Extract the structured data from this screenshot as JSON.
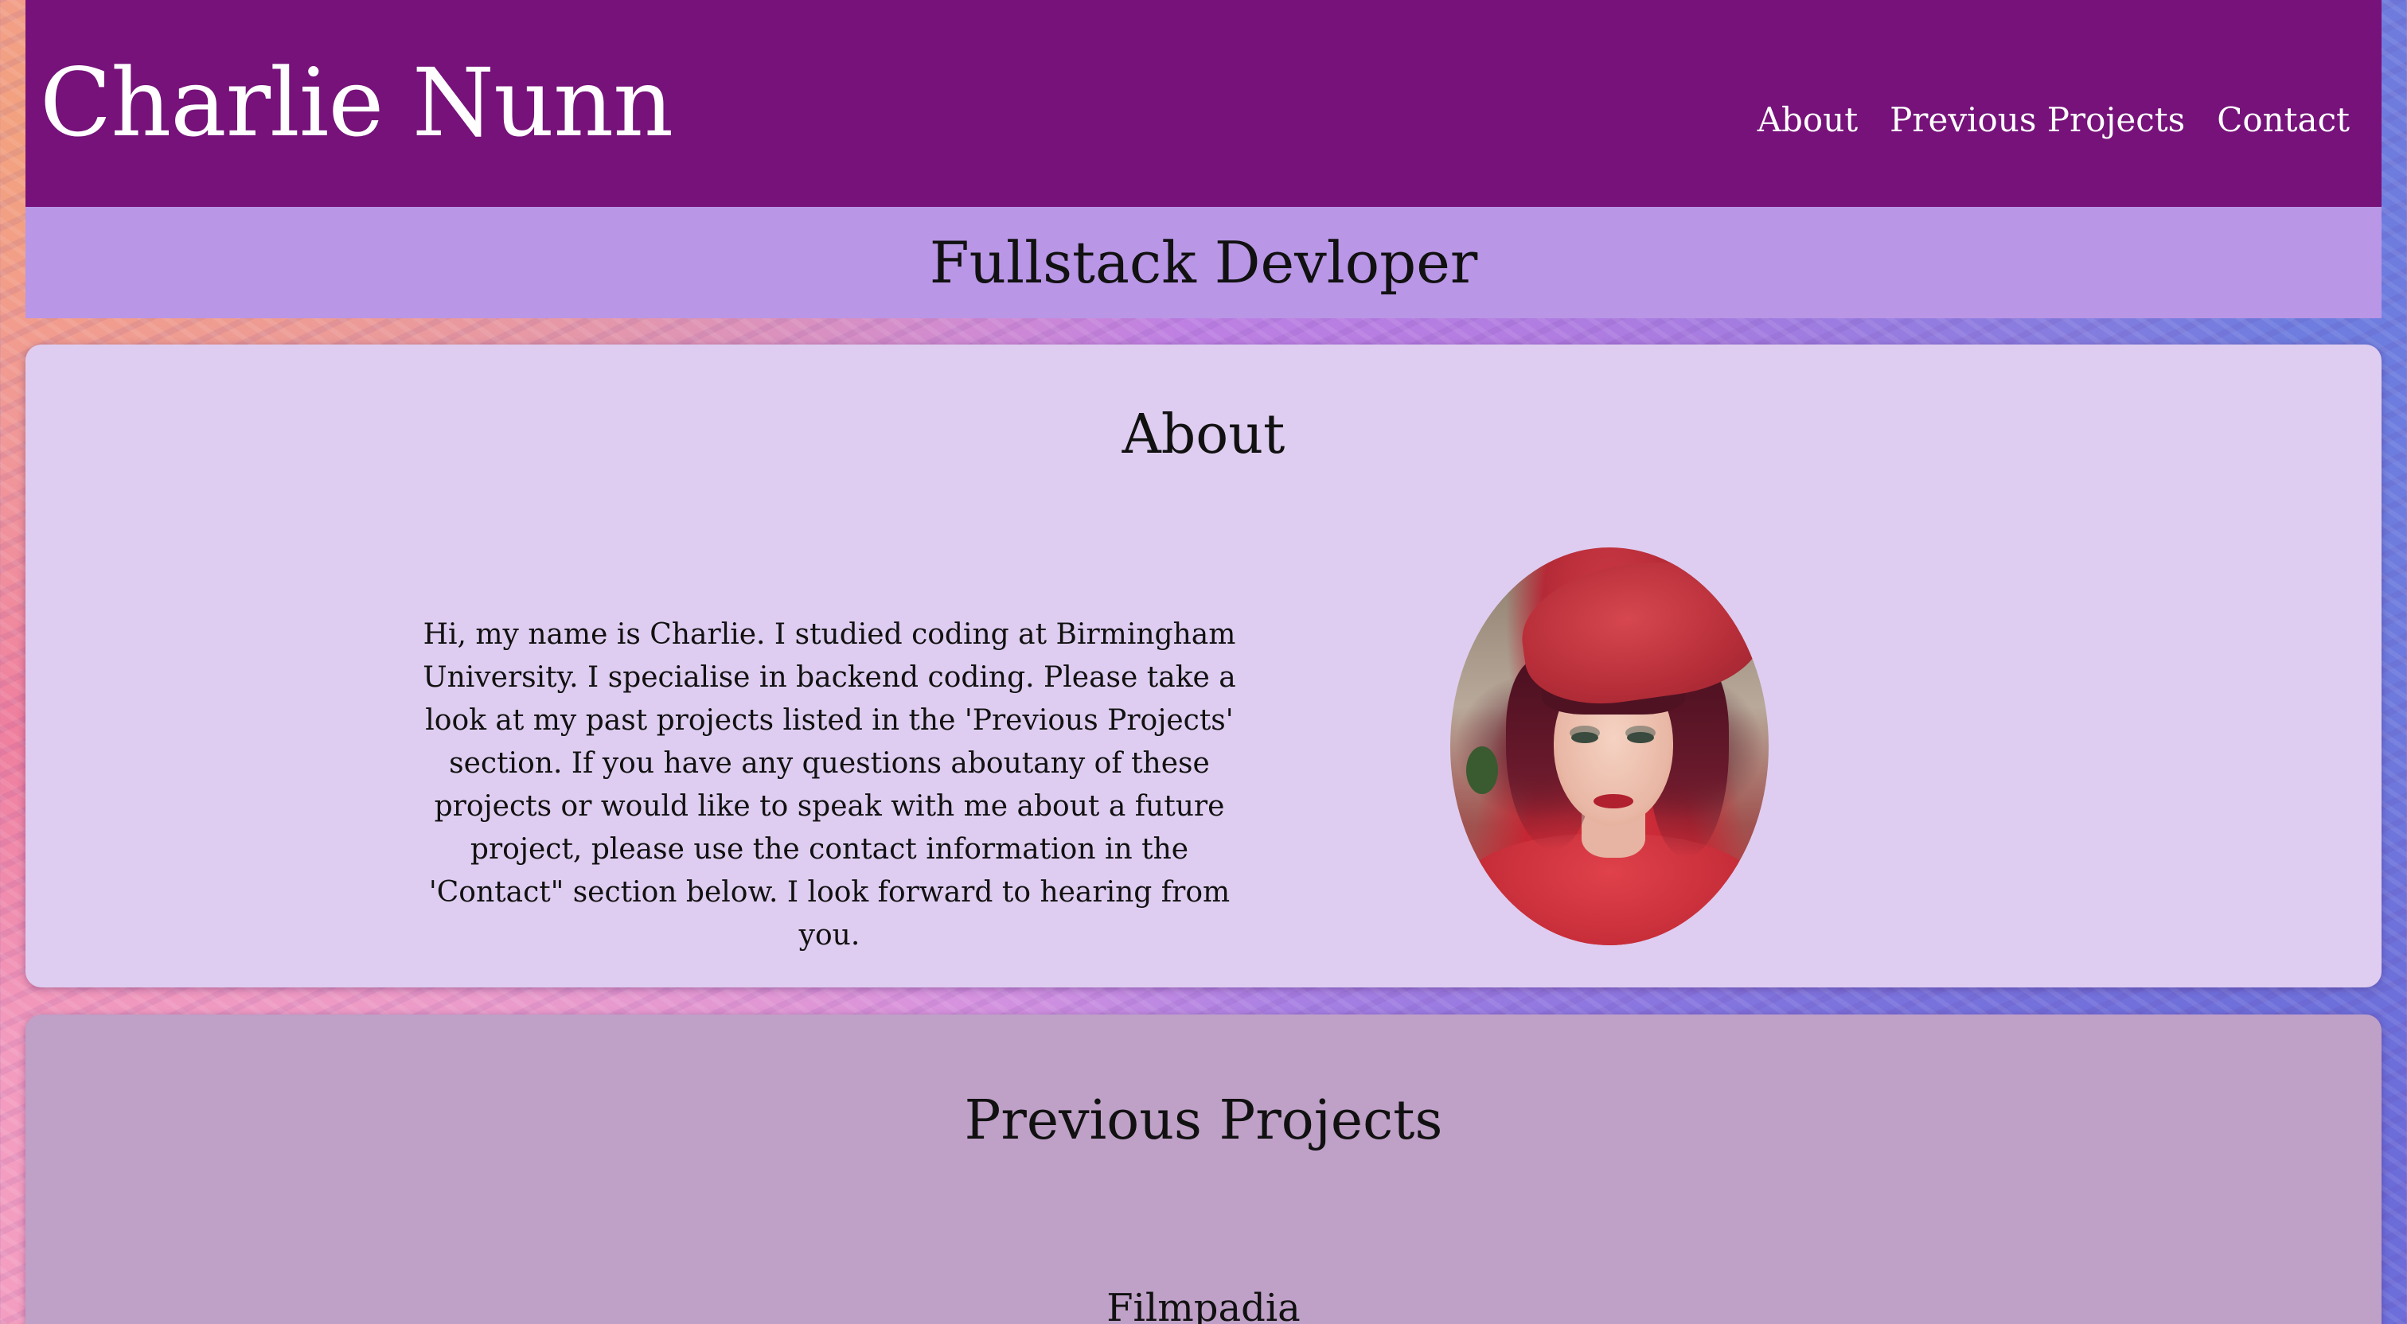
{
  "header": {
    "site_title": "Charlie Nunn",
    "nav": [
      {
        "label": "About"
      },
      {
        "label": "Previous Projects"
      },
      {
        "label": "Contact"
      }
    ]
  },
  "subtitle": "Fullstack Devloper",
  "about": {
    "heading": "About",
    "text": "Hi, my name is Charlie. I studied coding at Birmingham University. I specialise in backend coding. Please take a look at my past projects listed in the 'Previous Projects' section. If you have any questions aboutany of these projects or would like to speak with me about a future project, please use the contact information in the 'Contact\" section below. I look forward to hearing from you."
  },
  "projects": {
    "heading": "Previous Projects",
    "items": [
      {
        "title": "Filmpadia"
      }
    ]
  },
  "colors": {
    "header_bg": "#76127a",
    "subtitle_bg": "#b996e6",
    "about_bg": "#decdf0",
    "projects_bg": "#bfa0c7"
  }
}
